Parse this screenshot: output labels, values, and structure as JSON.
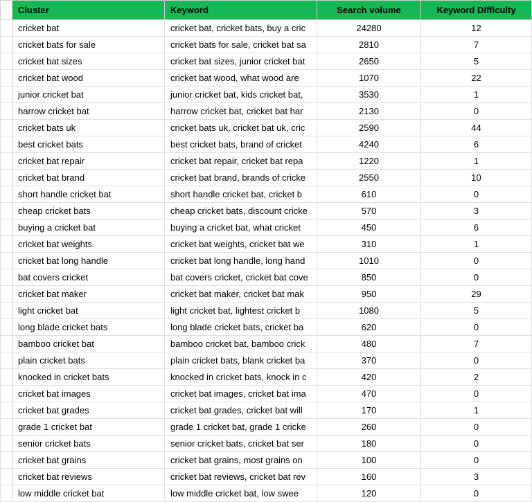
{
  "headers": {
    "cluster": "Cluster",
    "keyword": "Keyword",
    "volume": "Search volume",
    "difficulty": "Keyword Difficulty"
  },
  "rows": [
    {
      "cluster": "cricket bat",
      "keyword": "cricket bat, cricket bats, buy a cric",
      "volume": "24280",
      "difficulty": "12"
    },
    {
      "cluster": "cricket bats for sale",
      "keyword": "cricket bats for sale, cricket bat sa",
      "volume": "2810",
      "difficulty": "7"
    },
    {
      "cluster": "cricket bat sizes",
      "keyword": "cricket bat sizes, junior cricket bat",
      "volume": "2650",
      "difficulty": "5"
    },
    {
      "cluster": "cricket bat wood",
      "keyword": "cricket bat wood, what wood are",
      "volume": "1070",
      "difficulty": "22"
    },
    {
      "cluster": "junior cricket bat",
      "keyword": "junior cricket bat, kids cricket bat,",
      "volume": "3530",
      "difficulty": "1"
    },
    {
      "cluster": "harrow cricket bat",
      "keyword": "harrow cricket bat, cricket bat har",
      "volume": "2130",
      "difficulty": "0"
    },
    {
      "cluster": "cricket bats uk",
      "keyword": "cricket bats uk, cricket bat uk, cric",
      "volume": "2590",
      "difficulty": "44"
    },
    {
      "cluster": "best cricket bats",
      "keyword": "best cricket bats, brand of cricket",
      "volume": "4240",
      "difficulty": "6"
    },
    {
      "cluster": "cricket bat repair",
      "keyword": "cricket bat repair, cricket bat repa",
      "volume": "1220",
      "difficulty": "1"
    },
    {
      "cluster": "cricket bat brand",
      "keyword": "cricket bat brand, brands of cricke",
      "volume": "2550",
      "difficulty": "10"
    },
    {
      "cluster": "short handle cricket bat",
      "keyword": "short handle cricket bat, cricket b",
      "volume": "610",
      "difficulty": "0"
    },
    {
      "cluster": "cheap cricket bats",
      "keyword": "cheap cricket bats, discount cricke",
      "volume": "570",
      "difficulty": "3"
    },
    {
      "cluster": "buying a cricket bat",
      "keyword": "buying a cricket bat, what cricket",
      "volume": "450",
      "difficulty": "6"
    },
    {
      "cluster": "cricket bat weights",
      "keyword": "cricket bat weights, cricket bat we",
      "volume": "310",
      "difficulty": "1"
    },
    {
      "cluster": "cricket bat long handle",
      "keyword": "cricket bat long handle, long hand",
      "volume": "1010",
      "difficulty": "0"
    },
    {
      "cluster": "bat covers cricket",
      "keyword": "bat covers cricket, cricket bat cove",
      "volume": "850",
      "difficulty": "0"
    },
    {
      "cluster": "cricket bat maker",
      "keyword": "cricket bat maker, cricket bat mak",
      "volume": "950",
      "difficulty": "29"
    },
    {
      "cluster": "light cricket bat",
      "keyword": "light cricket bat, lightest cricket b",
      "volume": "1080",
      "difficulty": "5"
    },
    {
      "cluster": "long blade cricket bats",
      "keyword": "long blade cricket bats, cricket ba",
      "volume": "620",
      "difficulty": "0"
    },
    {
      "cluster": "bamboo cricket bat",
      "keyword": "bamboo cricket bat, bamboo crick",
      "volume": "480",
      "difficulty": "7"
    },
    {
      "cluster": "plain cricket bats",
      "keyword": "plain cricket bats, blank cricket ba",
      "volume": "370",
      "difficulty": "0"
    },
    {
      "cluster": "knocked in cricket bats",
      "keyword": "knocked in cricket bats, knock in c",
      "volume": "420",
      "difficulty": "2"
    },
    {
      "cluster": "cricket bat images",
      "keyword": "cricket bat images, cricket bat ima",
      "volume": "470",
      "difficulty": "0"
    },
    {
      "cluster": "cricket bat grades",
      "keyword": "cricket bat grades, cricket bat will",
      "volume": "170",
      "difficulty": "1"
    },
    {
      "cluster": "grade 1 cricket bat",
      "keyword": "grade 1 cricket bat, grade 1 cricke",
      "volume": "260",
      "difficulty": "0"
    },
    {
      "cluster": "senior cricket bats",
      "keyword": "senior cricket bats, cricket bat ser",
      "volume": "180",
      "difficulty": "0"
    },
    {
      "cluster": "cricket bat grains",
      "keyword": "cricket bat grains, most grains on",
      "volume": "100",
      "difficulty": "0"
    },
    {
      "cluster": "cricket bat reviews",
      "keyword": "cricket bat reviews, cricket bat rev",
      "volume": "160",
      "difficulty": "3"
    },
    {
      "cluster": "low middle cricket bat",
      "keyword": "low middle cricket bat, low swee",
      "volume": "120",
      "difficulty": "0"
    }
  ]
}
